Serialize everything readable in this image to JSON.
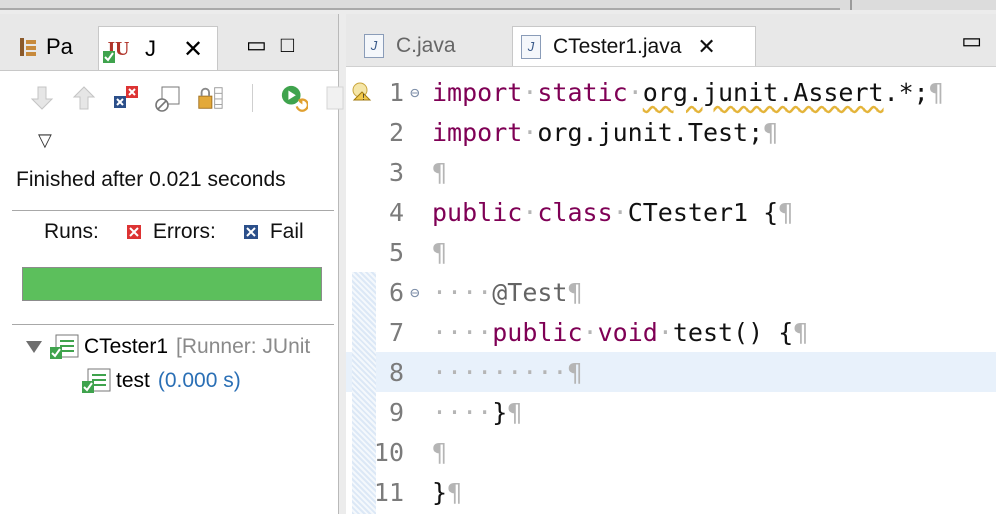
{
  "left_panel": {
    "tabs": [
      {
        "label": "Pa",
        "icon": "package-explorer-icon"
      },
      {
        "label": "J",
        "icon": "junit-icon"
      }
    ],
    "status": "Finished after 0.021 seconds",
    "counters": {
      "runs_label": "Runs:",
      "errors_label": "Errors:",
      "failures_label": "Fail"
    },
    "progress": {
      "fraction": 1.0,
      "color": "#5cbf5c"
    },
    "tree": [
      {
        "name": "CTester1",
        "suffix": "[Runner: JUnit"
      },
      {
        "name": "test",
        "time": "(0.000 s)"
      }
    ]
  },
  "editor": {
    "tabs": [
      {
        "label": "C.java"
      },
      {
        "label": "CTester1.java"
      }
    ],
    "line_numbers": [
      "1",
      "2",
      "3",
      "4",
      "5",
      "6",
      "7",
      "8",
      "9",
      "10",
      "11"
    ],
    "code": {
      "l1_kw1": "import",
      "l1_kw2": "static",
      "l1_pkg": "org.junit.Assert",
      "l1_rest": ".*;",
      "l2_kw": "import",
      "l2_rest": "org.junit.Test;",
      "l4_kw1": "public",
      "l4_kw2": "class",
      "l4_rest": "CTester1 {",
      "l6_ann": "@Test",
      "l7_kw1": "public",
      "l7_kw2": "void",
      "l7_rest": "test() {",
      "l9_rest": "}",
      "l11_rest": "}",
      "pilcrow": "¶"
    }
  },
  "colors": {
    "keyword": "#7f0055",
    "whitespace_marker": "#b5b5b5",
    "current_line": "#e8f1fb",
    "duration": "#2a6fb5"
  }
}
